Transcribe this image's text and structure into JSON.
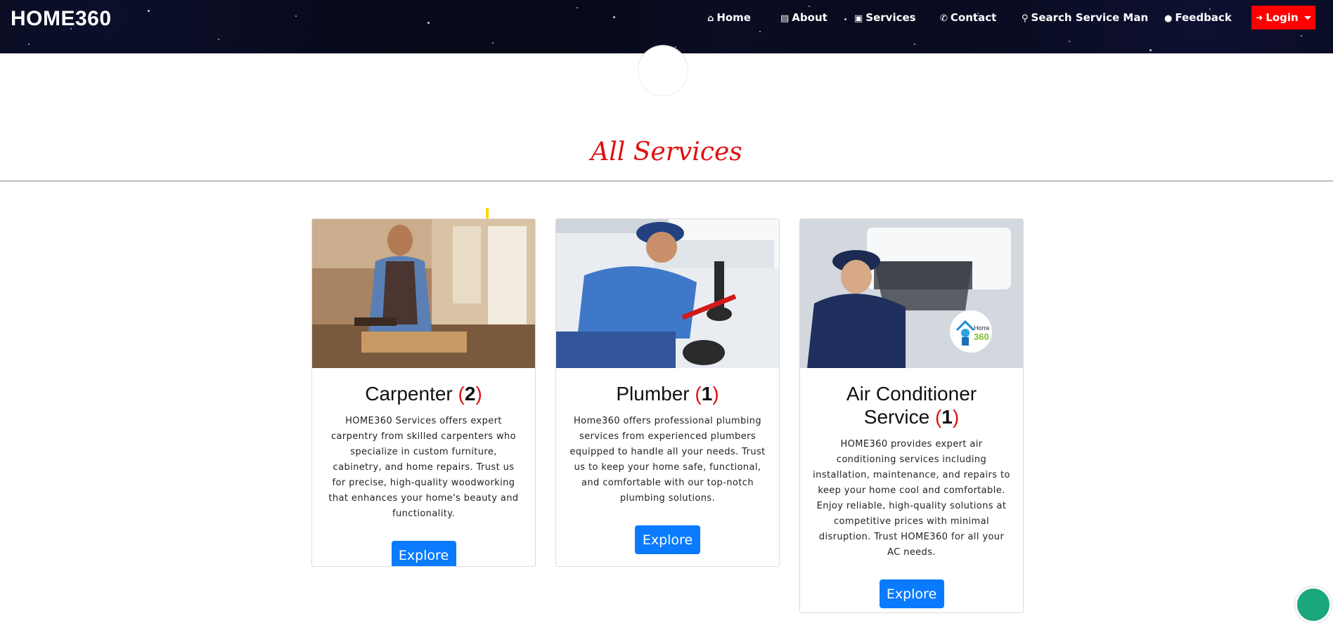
{
  "brand": "HOME360",
  "nav": {
    "items": [
      {
        "icon": "home-icon",
        "glyph": "⌂",
        "label": "Home"
      },
      {
        "icon": "file-icon",
        "glyph": "▤",
        "label": "About"
      },
      {
        "icon": "briefcase-icon",
        "glyph": "▣",
        "label": "Services"
      },
      {
        "icon": "phone-icon",
        "glyph": "✆",
        "label": "Contact"
      },
      {
        "icon": "search-icon",
        "glyph": "⚲",
        "label": "Search Service Man"
      },
      {
        "icon": "comment-icon",
        "glyph": "●",
        "label": "Feedback"
      }
    ],
    "login": {
      "icon": "sign-in-icon",
      "glyph": "➜",
      "label": "Login"
    }
  },
  "main": {
    "title": "All Services",
    "cards": [
      {
        "name": "Carpenter",
        "count": "2",
        "description": "HOME360 Services offers expert carpentry from skilled carpenters who specialize in custom furniture, cabinetry, and home repairs. Trust us for precise, high-quality woodworking that enhances your home's beauty and functionality.",
        "button": "Explore"
      },
      {
        "name": "Plumber",
        "count": "1",
        "description": "Home360 offers professional plumbing services from experienced plumbers equipped to handle all your needs. Trust us to keep your home safe, functional, and comfortable with our top-notch plumbing solutions.",
        "button": "Explore"
      },
      {
        "name": "Air Conditioner Service",
        "count": "1",
        "description": "HOME360 provides expert air conditioning services including installation, maintenance, and repairs to keep your home cool and comfortable. Enjoy reliable, high-quality solutions at competitive prices with minimal disruption. Trust HOME360 for all your AC needs.",
        "button": "Explore",
        "badge_logo_text": "Home 360"
      }
    ]
  },
  "colors": {
    "accent_red": "#e01010",
    "login_red": "#ff0000",
    "button_blue": "#0a7bff",
    "navbar_bg": "#05060f"
  }
}
